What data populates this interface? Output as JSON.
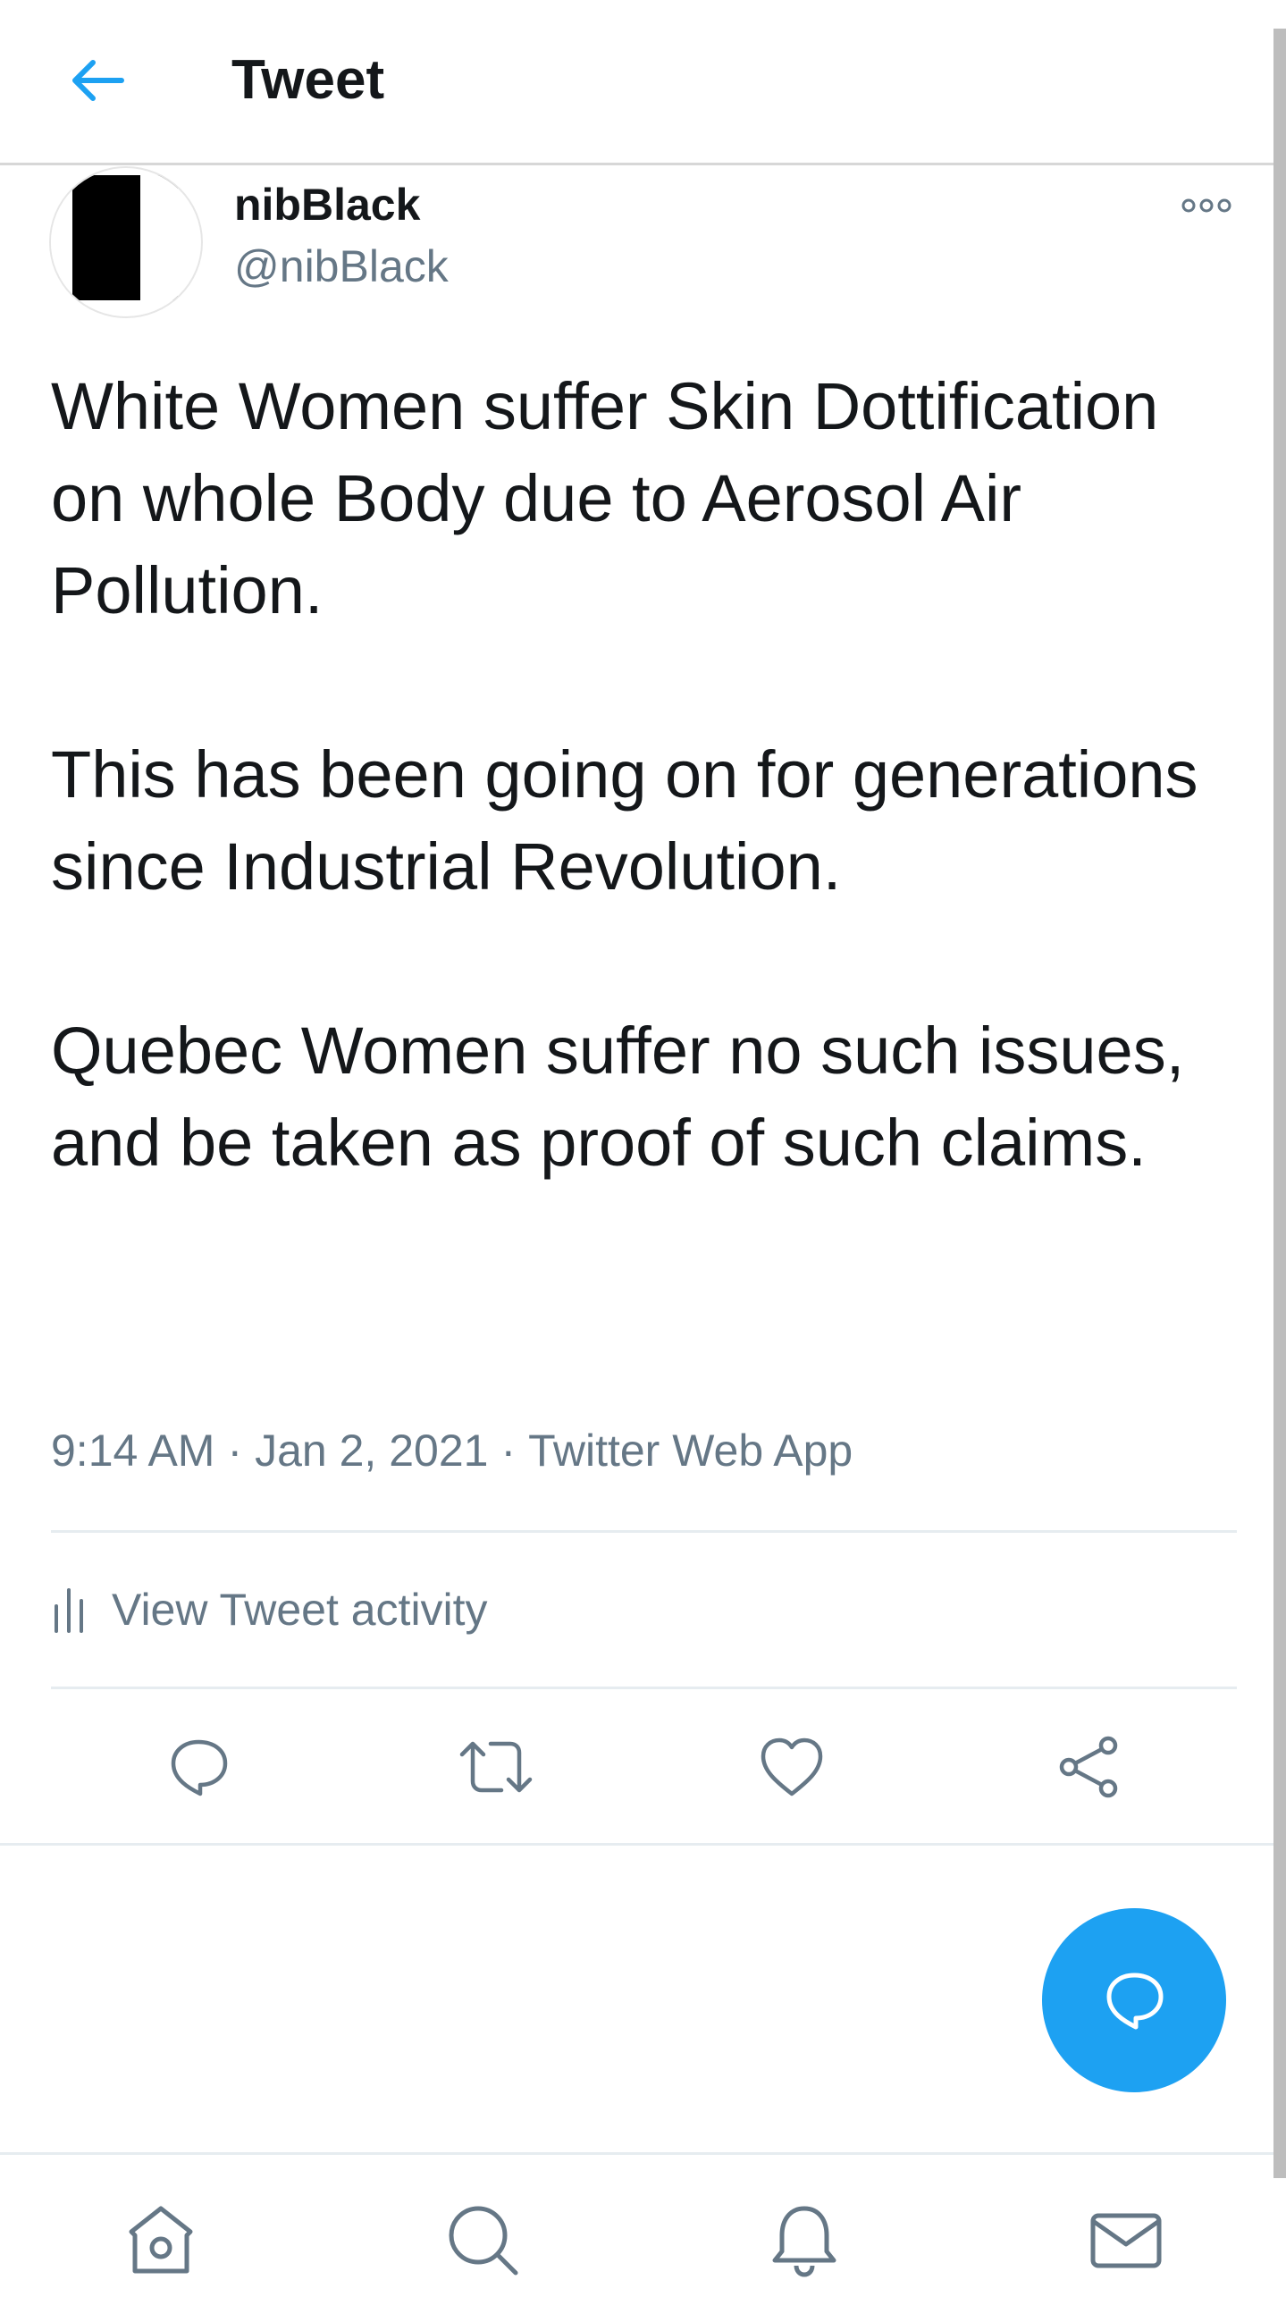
{
  "header": {
    "title": "Tweet",
    "back_icon": "arrow-left-icon"
  },
  "author": {
    "display_name": "nibBlack",
    "handle": "@nibBlack"
  },
  "tweet": {
    "paragraphs": [
      "White Women suffer Skin Dottification on whole Body due to Aerosol Air Pollution.",
      "This has been going on for generations since Industrial Revolution.",
      "Quebec Women suffer no such issues, and be taken as proof of such claims."
    ],
    "time": "9:14 AM",
    "date": "Jan 2, 2021",
    "source": "Twitter Web App",
    "separator": "·"
  },
  "activity": {
    "label": "View Tweet activity"
  },
  "actions": [
    "reply-icon",
    "retweet-icon",
    "like-icon",
    "share-icon"
  ],
  "nav": [
    "home-icon",
    "search-icon",
    "notifications-icon",
    "messages-icon"
  ],
  "colors": {
    "accent": "#1da1f2",
    "text": "#14171a",
    "secondary": "#657786",
    "divider": "#e6ecf0"
  }
}
